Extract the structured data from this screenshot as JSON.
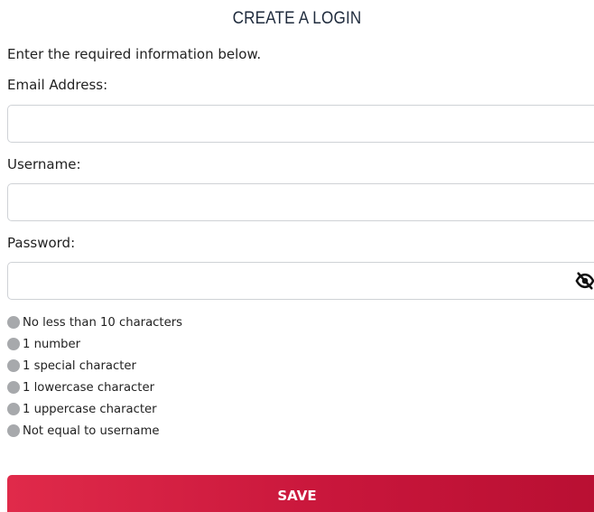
{
  "form": {
    "title": "CREATE A LOGIN",
    "intro": "Enter the required information below.",
    "email_label": "Email Address:",
    "email_value": "",
    "username_label": "Username:",
    "username_value": "",
    "password_label": "Password:",
    "password_value": "",
    "password_toggle_icon": "eye-slash-icon",
    "rules": [
      "No less than 10 characters",
      "1 number",
      "1 special character",
      "1 lowercase character",
      "1 uppercase character",
      "Not equal to username"
    ],
    "rule_status_color": "#a7a9ac",
    "save_label": "SAVE",
    "save_color": "#c8163b"
  }
}
